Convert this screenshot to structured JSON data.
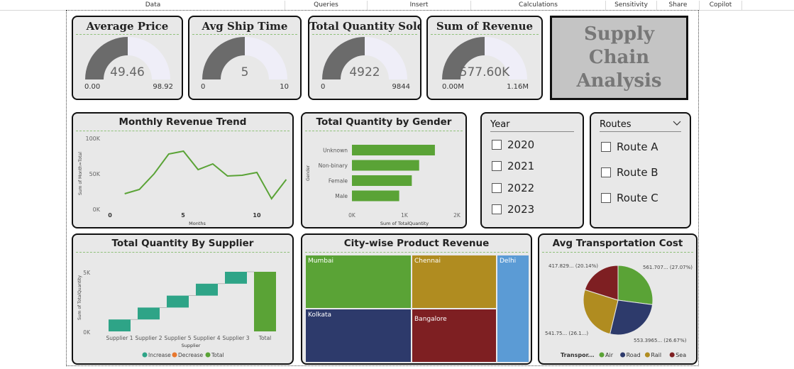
{
  "ribbon": {
    "tabs": [
      "Data",
      "Queries",
      "Insert",
      "Calculations",
      "Sensitivity",
      "Share",
      "Copilot"
    ]
  },
  "kpis": [
    {
      "title": "Average Price",
      "value": "49.46",
      "min": "0.00",
      "max": "98.92",
      "fill": 0.5
    },
    {
      "title": "Avg Ship Time",
      "value": "5",
      "min": "0",
      "max": "10",
      "fill": 0.5
    },
    {
      "title": "Total Quantity Sold",
      "value": "4922",
      "min": "0",
      "max": "9844",
      "fill": 0.5
    },
    {
      "title": "Sum of Revenue",
      "value": "577.60K",
      "min": "0.00M",
      "max": "1.16M",
      "fill": 0.5
    }
  ],
  "banner": {
    "line1": "Supply",
    "line2": "Chain",
    "line3": "Analysis"
  },
  "colors": {
    "green": "#5aa336",
    "gauge_dark": "#6b6b6b",
    "gauge_light": "#efeef8",
    "teal": "#2ea487",
    "orange": "#e8772e"
  },
  "monthly_trend": {
    "title": "Monthly Revenue Trend",
    "xlabel": "Months",
    "ylabel": "Sum of Month=Total",
    "yticks": [
      "100K",
      "50K",
      "0K"
    ],
    "xticks": [
      "0",
      "5",
      "10"
    ],
    "chart_data": {
      "type": "line",
      "x": [
        1,
        2,
        3,
        4,
        5,
        6,
        7,
        8,
        9,
        10,
        11,
        12
      ],
      "y": [
        22000,
        28000,
        50000,
        78000,
        82000,
        56000,
        64000,
        47000,
        48000,
        52000,
        15000,
        42000
      ],
      "xlim": [
        0,
        12
      ],
      "ylim": [
        0,
        100000
      ]
    }
  },
  "gender": {
    "title": "Total Quantity by Gender",
    "ylabel": "Gender",
    "xlabel": "Sum of TotalQuantity",
    "xticks": [
      "0K",
      "1K",
      "2K"
    ],
    "chart_data": {
      "type": "bar",
      "categories": [
        "Unknown",
        "Non-binary",
        "Female",
        "Male"
      ],
      "values": [
        1580,
        1280,
        1140,
        900
      ],
      "xlim": [
        0,
        2000
      ]
    }
  },
  "year_slicer": {
    "title": "Year",
    "options": [
      "2020",
      "2021",
      "2022",
      "2023"
    ]
  },
  "route_slicer": {
    "title": "Routes",
    "options": [
      "Route A",
      "Route B",
      "Route C"
    ]
  },
  "supplier": {
    "title": "Total Quantity By Supplier",
    "ylabel": "Sum of TotalQuantity",
    "xlabel": "Supplier",
    "yticks": [
      "5K",
      "0K"
    ],
    "legend": [
      "Increase",
      "Decrease",
      "Total"
    ],
    "chart_data": {
      "type": "bar",
      "categories": [
        "Supplier 1",
        "Supplier 2",
        "Supplier 5",
        "Supplier 4",
        "Supplier 3",
        "Total"
      ],
      "values": [
        1000,
        1000,
        1000,
        1000,
        1000,
        5000
      ],
      "ylim": [
        0,
        6000
      ]
    }
  },
  "city": {
    "title": "City-wise Product Revenue",
    "tiles": [
      {
        "name": "Mumbai",
        "color": "#5aa336"
      },
      {
        "name": "Chennai",
        "color": "#b08c20"
      },
      {
        "name": "Delhi",
        "color": "#5b9bd5"
      },
      {
        "name": "Kolkata",
        "color": "#2d3a6b"
      },
      {
        "name": "Bangalore",
        "color": "#7e1f22"
      }
    ]
  },
  "transport": {
    "title": "Avg Transportation Cost",
    "legend_title": "Transpor...",
    "labels": [
      "561.707... (27.07%)",
      "553.3965... (26.67%)",
      "541.75... (26.1...)",
      "417.829... (20.14%)"
    ],
    "chart_data": {
      "type": "pie",
      "categories": [
        "Air",
        "Road",
        "Rail",
        "Sea"
      ],
      "values": [
        27.07,
        26.67,
        26.12,
        20.14
      ],
      "colors": [
        "#5aa336",
        "#2d3a6b",
        "#b08c20",
        "#7e1f22"
      ]
    }
  }
}
